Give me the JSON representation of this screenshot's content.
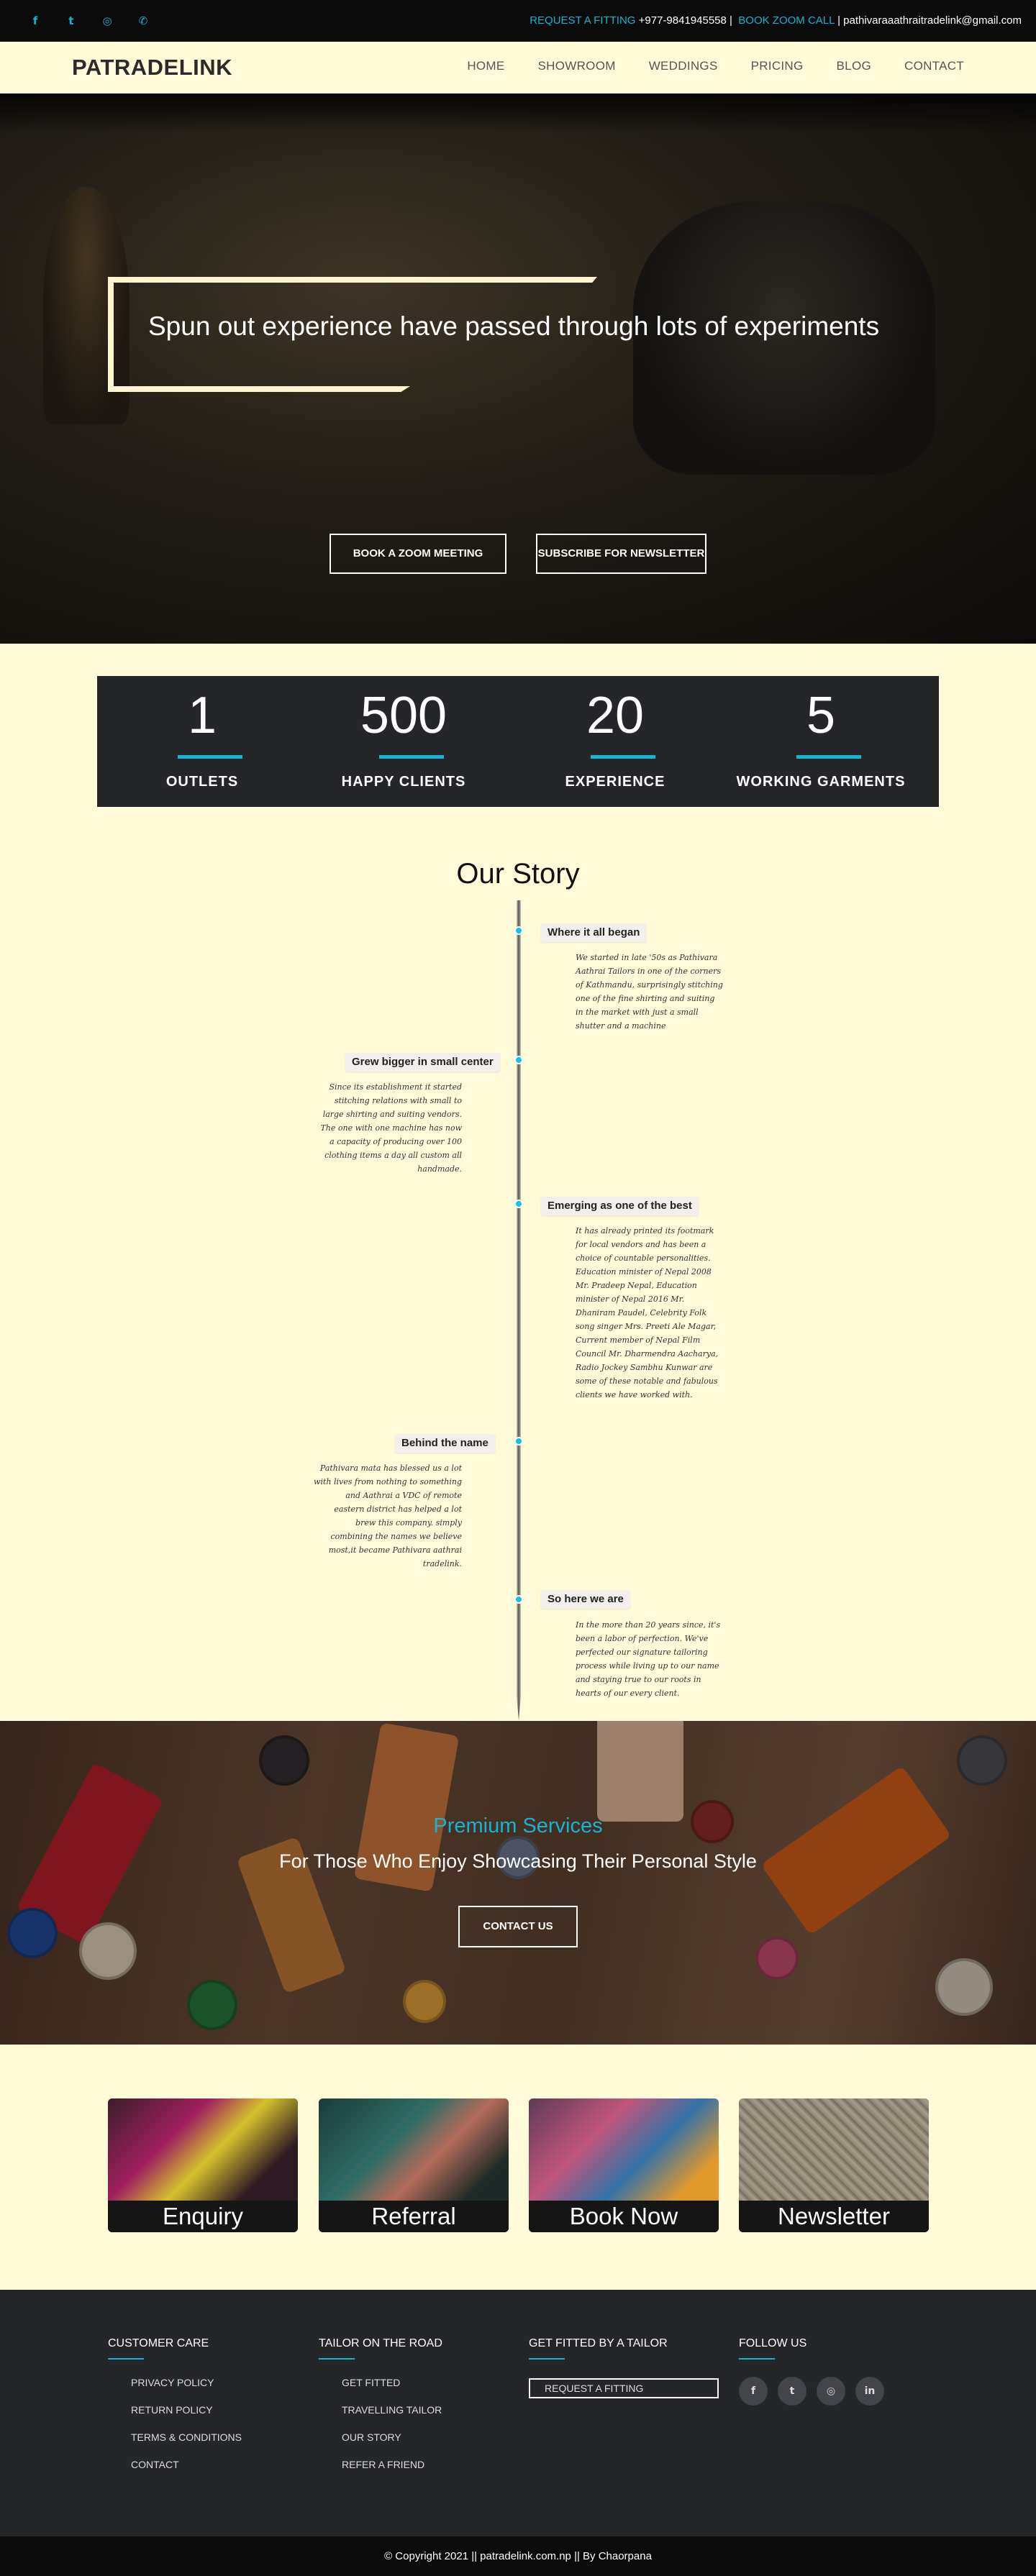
{
  "topbar": {
    "socials": [
      {
        "icon": "facebook-icon",
        "glyph": "f"
      },
      {
        "icon": "twitter-icon",
        "glyph": "t"
      },
      {
        "icon": "instagram-icon",
        "glyph": "◎"
      },
      {
        "icon": "whatsapp-icon",
        "glyph": "✆"
      }
    ],
    "fitting_label": "REQUEST A FITTING",
    "phone": "+977-9841945558 |",
    "zoom_label": "BOOK ZOOM CALL",
    "email": "| pathivaraaathraitradelink@gmail.com"
  },
  "nav": {
    "brand": "PATRADELINK",
    "items": [
      "HOME",
      "SHOWROOM",
      "WEDDINGS",
      "PRICING",
      "BLOG",
      "CONTACT"
    ]
  },
  "hero": {
    "headline": "Spun out experience have passed through lots of experiments",
    "btn_zoom": "BOOK A ZOOM MEETING",
    "btn_newsletter": "SUBSCRIBE FOR NEWSLETTER"
  },
  "stats": [
    {
      "value": "1",
      "label": "OUTLETS"
    },
    {
      "value": "500",
      "label": "HAPPY CLIENTS"
    },
    {
      "value": "20",
      "label": "EXPERIENCE"
    },
    {
      "value": "5",
      "label": "WORKING GARMENTS"
    }
  ],
  "story": {
    "title": "Our Story",
    "events": [
      {
        "title": "Where it all began",
        "body": "We started in late '50s as Pathivara Aathrai Tailors in one of the corners of Kathmandu, surprisingly stitching one of the fine shirting and suiting in the market with just a small shutter and a machine"
      },
      {
        "title": "Grew bigger in small center",
        "body": "Since its establishment it started stitching relations with small to large shirting and suiting vendors. The one with one machine has now a capacity of producing over 100 clothing items a day all custom all handmade."
      },
      {
        "title": "Emerging as one of the best",
        "body": "It has already printed its footmark for local vendors and has been a choice of countable personalities. Education minister of Nepal 2008 Mr. Pradeep Nepal, Education minister of Nepal 2016 Mr. Dhaniram Paudel, Celebrity Folk song singer Mrs. Preeti Ale Magar, Current member of Nepal Film Council Mr. Dharmendra Aacharya, Radio Jockey Sambhu Kunwar are some of these notable and fabulous clients we have worked with."
      },
      {
        "title": "Behind the name",
        "body": "Pathivara mata has blessed us a lot with lives from nothing to something and Aathrai a VDC of remote eastern district has helped a lot brew this company. simply combining the names we believe most,it became Pathivara aathrai tradelink."
      },
      {
        "title": "So here we are",
        "body": "In the more than 20 years since, it's been a labor of perfection. We've perfected our signature tailoring process while living up to our name and staying true to our roots in hearts of our every client."
      }
    ]
  },
  "premium": {
    "subtitle": "Premium Services",
    "title": "For Those Who Enjoy Showcasing Their Personal Style",
    "button": "CONTACT US"
  },
  "cards": [
    {
      "label": "Enquiry"
    },
    {
      "label": "Referral"
    },
    {
      "label": "Book Now"
    },
    {
      "label": "Newsletter"
    }
  ],
  "footer": {
    "customer_care": {
      "title": "CUSTOMER CARE",
      "links": [
        "PRIVACY POLICY",
        "RETURN POLICY",
        "TERMS & CONDITIONS",
        "CONTACT"
      ]
    },
    "tailor": {
      "title": "TAILOR ON THE ROAD",
      "links": [
        "GET FITTED",
        "TRAVELLING TAILOR",
        "OUR STORY",
        "REFER A FRIEND"
      ]
    },
    "fitted": {
      "title": "GET FITTED BY A TAILOR",
      "button": "REQUEST A FITTING"
    },
    "follow": {
      "title": "FOLLOW US",
      "icons": [
        {
          "icon": "facebook-icon",
          "glyph": "f"
        },
        {
          "icon": "twitter-icon",
          "glyph": "t"
        },
        {
          "icon": "instagram-icon",
          "glyph": "◎"
        },
        {
          "icon": "linkedin-icon",
          "glyph": "in"
        }
      ]
    }
  },
  "copyright": "© Copyright 2021 || patradelink.com.np || By Chaorpana",
  "colors": {
    "accent": "#17b3d3",
    "background": "#fffbd9",
    "dark": "#25262a"
  }
}
